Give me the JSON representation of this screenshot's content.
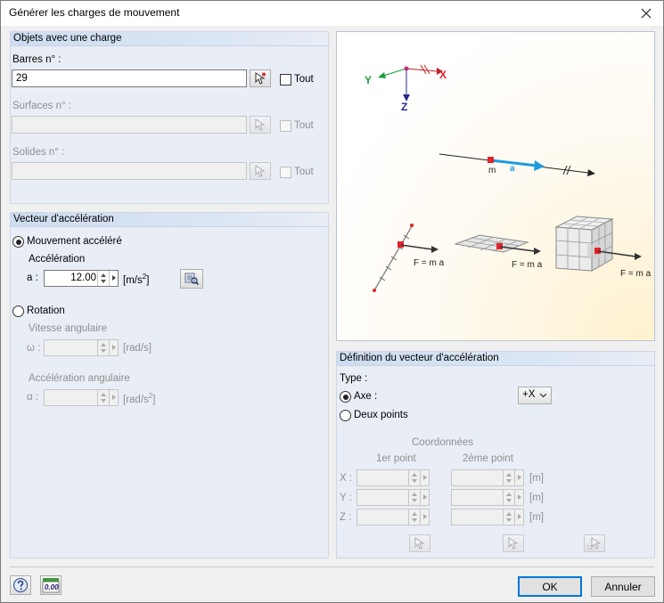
{
  "window": {
    "title": "Générer les charges de mouvement"
  },
  "objects": {
    "header": "Objets avec une charge",
    "members_label": "Barres n° :",
    "members_value": "29",
    "surfaces_label": "Surfaces n° :",
    "surfaces_value": "",
    "solids_label": "Solides n° :",
    "solids_value": "",
    "all_label": "Tout"
  },
  "accel_vector": {
    "header": "Vecteur d'accélération",
    "accelerated_motion": "Mouvement accéléré",
    "acceleration_label": "Accélération",
    "a_label": "a :",
    "a_value": "12.00",
    "a_unit_base": "[m/s",
    "a_unit_exp": "2",
    "a_unit_close": "]",
    "rotation": "Rotation",
    "angular_velocity_label": "Vitesse angulaire",
    "omega_label": "ω :",
    "omega_unit": "[rad/s]",
    "angular_accel_label": "Accélération angulaire",
    "alpha_label": "α :",
    "alpha_unit_base": "[rad/s",
    "alpha_unit_exp": "2",
    "alpha_unit_close": "]"
  },
  "preview": {
    "axis_x": "X",
    "axis_y": "Y",
    "axis_z": "Z",
    "mass_label": "m",
    "accel_label": "a",
    "force_label": "F = m a"
  },
  "definition": {
    "header": "Définition du vecteur d'accélération",
    "type_label": "Type :",
    "axis_label": "Axe :",
    "axis_value": "+X",
    "two_points_label": "Deux points",
    "coords_label": "Coordonnées",
    "point1_label": "1er point",
    "point2_label": "2ème point",
    "x_label": "X :",
    "y_label": "Y :",
    "z_label": "Z :",
    "unit_m": "[m]"
  },
  "footer": {
    "ok": "OK",
    "cancel": "Annuler",
    "units_icon_text": "0.00"
  },
  "colors": {
    "accent": "#0078d7",
    "axis_x": "#e0242a",
    "axis_y": "#1e9e3a",
    "axis_z": "#2a2a8c",
    "accel_arrow": "#1e9be0",
    "mass_point": "#e0242a"
  }
}
